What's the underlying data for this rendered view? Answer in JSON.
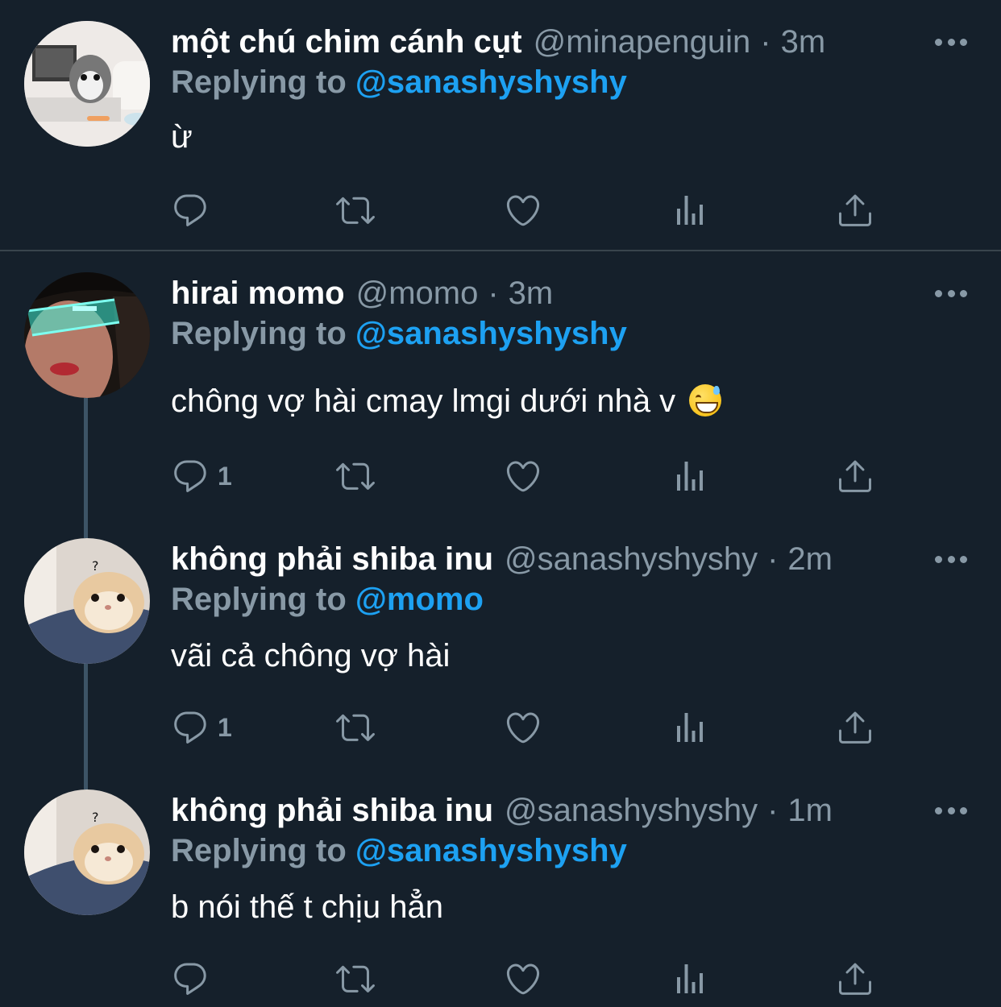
{
  "tweets": [
    {
      "name": "một chú chim cánh cụt",
      "handle": "@minapenguin",
      "separator": "·",
      "time": "3m",
      "replying_prefix": "Replying to",
      "replying_to": "@sanashyshyshy",
      "text": "ừ",
      "reply_count": ""
    },
    {
      "name": "hirai momo",
      "handle": "@momo",
      "separator": "·",
      "time": "3m",
      "replying_prefix": "Replying to",
      "replying_to": "@sanashyshyshy",
      "text": "chông vợ hài cmay lmgi dưới nhà v",
      "emoji": "grinning-face-with-sweat",
      "reply_count": "1"
    },
    {
      "name": "không phải shiba inu",
      "handle": "@sanashyshyshy",
      "separator": "·",
      "time": "2m",
      "replying_prefix": "Replying to",
      "replying_to": "@momo",
      "text": "vãi cả chông vợ hài",
      "reply_count": "1"
    },
    {
      "name": "không phải shiba inu",
      "handle": "@sanashyshyshy",
      "separator": "·",
      "time": "1m",
      "replying_prefix": "Replying to",
      "replying_to": "@sanashyshyshy",
      "text": "b nói thế t chịu hẳn",
      "reply_count": ""
    }
  ],
  "icons": [
    "reply-icon",
    "retweet-icon",
    "like-icon",
    "analytics-icon",
    "share-icon",
    "more-icon"
  ],
  "colors": {
    "background": "#15202b",
    "text": "#ffffff",
    "muted": "#8899a6",
    "accent": "#1da1f2",
    "divider": "#38444d"
  }
}
